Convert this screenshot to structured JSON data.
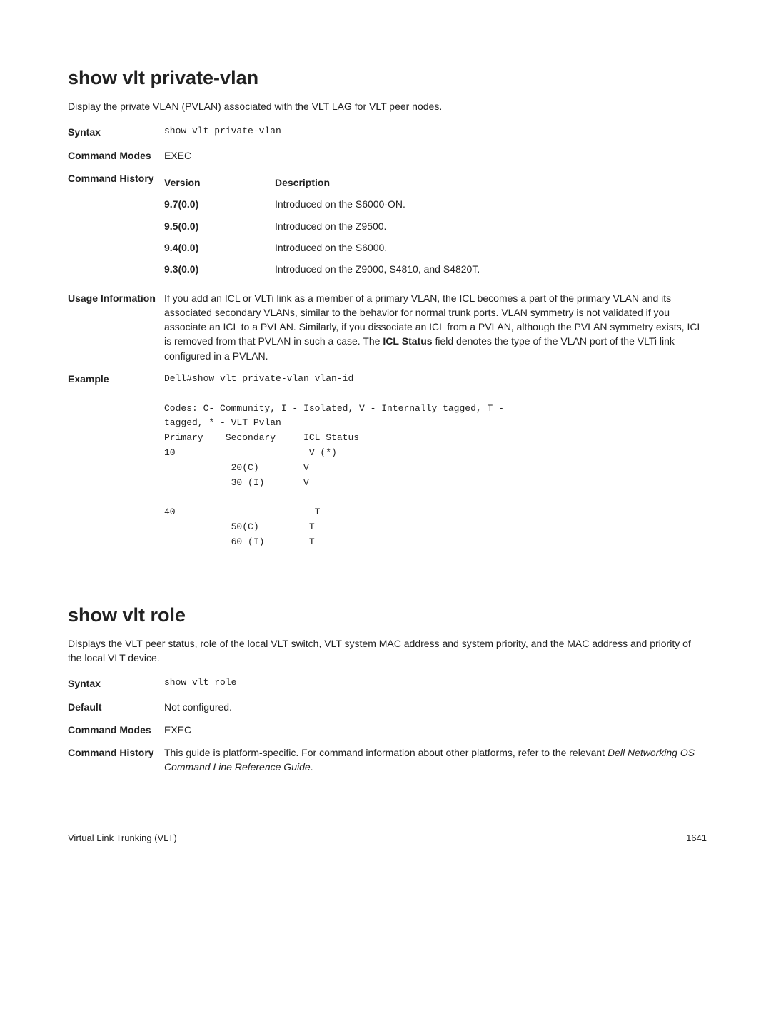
{
  "section1": {
    "heading": "show vlt private-vlan",
    "intro": "Display the private VLAN (PVLAN) associated with the VLT LAG for VLT peer nodes.",
    "syntaxLabel": "Syntax",
    "syntaxValue": "show vlt private-vlan",
    "cmdModesLabel": "Command Modes",
    "cmdModesValue": "EXEC",
    "historyLabel": "Command History",
    "historyVersionHeader": "Version",
    "historyDescHeader": "Description",
    "history": [
      {
        "ver": "9.7(0.0)",
        "desc": "Introduced on the S6000-ON."
      },
      {
        "ver": "9.5(0.0)",
        "desc": "Introduced on the Z9500."
      },
      {
        "ver": "9.4(0.0)",
        "desc": "Introduced on the S6000."
      },
      {
        "ver": "9.3(0.0)",
        "desc": "Introduced on the Z9000, S4810, and S4820T."
      }
    ],
    "usageLabel": "Usage Information",
    "usage_pre": "If you add an ICL or VLTi link as a member of a primary VLAN, the ICL becomes a part of the primary VLAN and its associated secondary VLANs, similar to the behavior for normal trunk ports. VLAN symmetry is not validated if you associate an ICL to a PVLAN. Similarly, if you dissociate an ICL from a PVLAN, although the PVLAN symmetry exists, ICL is removed from that PVLAN in such a case. The ",
    "usage_b1": "ICL",
    "usage_mid": " ",
    "usage_b2": "Status",
    "usage_post": " field denotes the type of the VLAN port of the VLTi link configured in a PVLAN.",
    "exampleLabel": "Example",
    "exampleCode": "Dell#show vlt private-vlan vlan-id\n\nCodes: C- Community, I - Isolated, V - Internally tagged, T - \ntagged, * - VLT Pvlan\nPrimary    Secondary     ICL Status\n10                        V (*)\n            20(C)        V\n            30 (I)       V\n\n40                         T\n            50(C)         T\n            60 (I)        T"
  },
  "section2": {
    "heading": "show vlt role",
    "intro": "Displays the VLT peer status, role of the local VLT switch, VLT system MAC address and system priority, and the MAC address and priority of the local VLT device.",
    "syntaxLabel": "Syntax",
    "syntaxValue": "show vlt role",
    "defaultLabel": "Default",
    "defaultValue": "Not configured.",
    "cmdModesLabel": "Command Modes",
    "cmdModesValue": "EXEC",
    "historyLabel": "Command History",
    "historyText_pre": "This guide is platform-specific. For command information about other platforms, refer to the relevant ",
    "historyText_ital": "Dell Networking OS Command Line Reference Guide",
    "historyText_post": "."
  },
  "footer": {
    "left": "Virtual Link Trunking (VLT)",
    "right": "1641"
  }
}
